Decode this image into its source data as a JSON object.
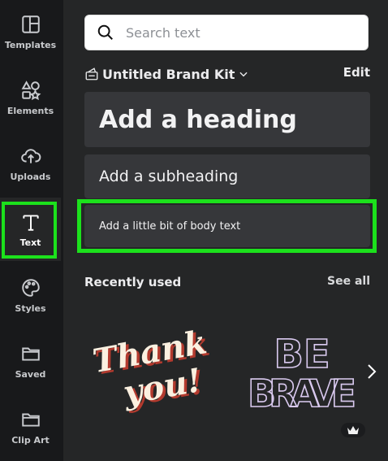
{
  "sidebar": {
    "items": [
      {
        "label": "Templates",
        "icon": "templates-icon"
      },
      {
        "label": "Elements",
        "icon": "elements-icon"
      },
      {
        "label": "Uploads",
        "icon": "uploads-icon"
      },
      {
        "label": "Text",
        "icon": "text-icon",
        "active": true
      },
      {
        "label": "Styles",
        "icon": "styles-icon"
      },
      {
        "label": "Saved",
        "icon": "folder-icon"
      },
      {
        "label": "Clip Art",
        "icon": "folder-icon"
      }
    ]
  },
  "search": {
    "placeholder": "Search text"
  },
  "brand_kit": {
    "title": "Untitled Brand Kit",
    "edit_label": "Edit"
  },
  "text_options": {
    "heading": "Add a heading",
    "subheading": "Add a subheading",
    "body": "Add a little bit of body text"
  },
  "recently_used": {
    "title": "Recently used",
    "see_all": "See all",
    "items": [
      {
        "line1": "Thank",
        "line2": "you!"
      },
      {
        "line1": "BE",
        "line2": "BRAVE"
      }
    ]
  },
  "colors": {
    "highlight": "#1ce11c",
    "sidebar_bg": "#18191b",
    "panel_bg": "#252627",
    "card_bg": "#36373a"
  }
}
